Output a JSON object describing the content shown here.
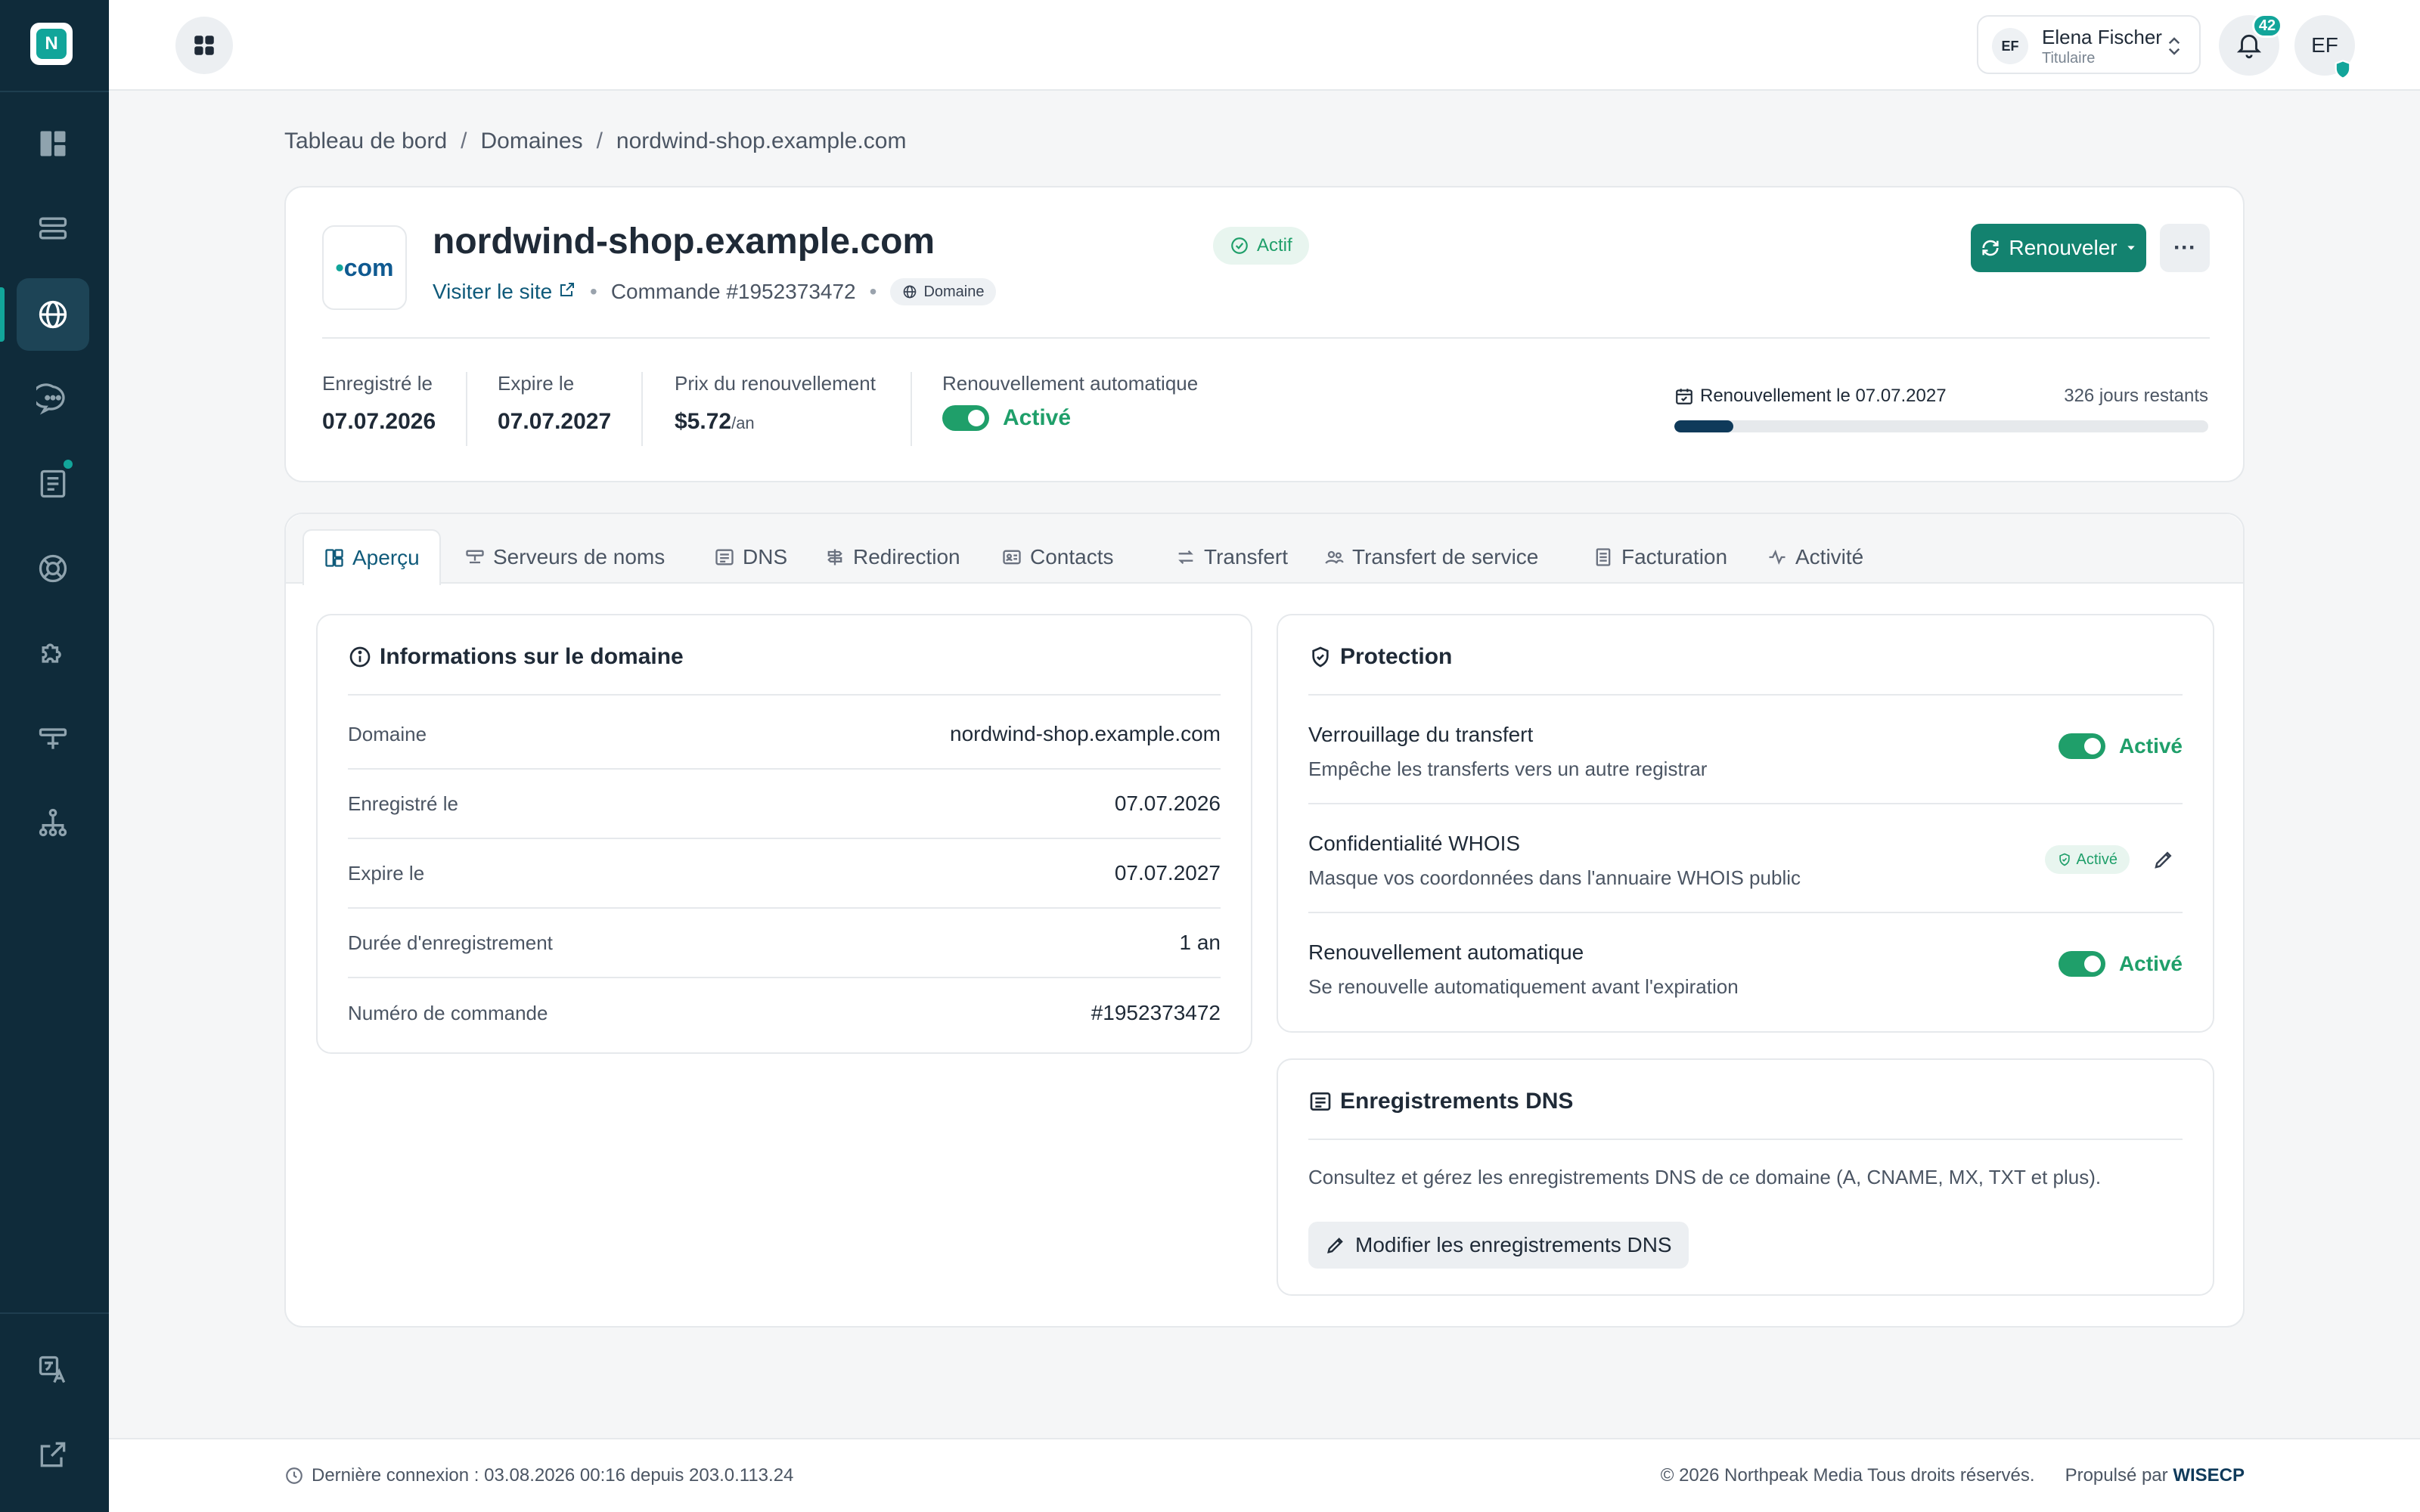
{
  "app": {
    "logo_letter": "N"
  },
  "user": {
    "name": "Elena Fischer",
    "role": "Titulaire",
    "initials": "EF",
    "notifications": "42"
  },
  "breadcrumb": [
    "Tableau de bord",
    "Domaines",
    "nordwind-shop.example.com"
  ],
  "domain": {
    "tld_dot": "•",
    "tld": "com",
    "name": "nordwind-shop.example.com",
    "status": "Actif",
    "visit_label": "Visiter le site",
    "order": "Commande #1952373472",
    "chip": "Domaine",
    "renew_button": "Renouveler",
    "more_button": "···"
  },
  "stats": {
    "registered_label": "Enregistré le",
    "registered_value": "07.07.2026",
    "expires_label": "Expire le",
    "expires_value": "07.07.2027",
    "price_label": "Prix du renouvellement",
    "price_value": "$5.72",
    "price_unit": "/an",
    "auto_label": "Renouvellement automatique",
    "auto_value": "Activé",
    "renewal_date": "Renouvellement le 07.07.2027",
    "days_left": "326 jours restants",
    "progress_pct": 11
  },
  "tabs": [
    "Aperçu",
    "Serveurs de noms",
    "DNS",
    "Redirection",
    "Contacts",
    "Transfert",
    "Transfert de service",
    "Facturation",
    "Activité"
  ],
  "info": {
    "title": "Informations sur le domaine",
    "rows": [
      {
        "k": "Domaine",
        "v": "nordwind-shop.example.com"
      },
      {
        "k": "Enregistré le",
        "v": "07.07.2026"
      },
      {
        "k": "Expire le",
        "v": "07.07.2027"
      },
      {
        "k": "Durée d'enregistrement",
        "v": "1 an"
      },
      {
        "k": "Numéro de commande",
        "v": "#1952373472"
      }
    ]
  },
  "protection": {
    "title": "Protection",
    "rows": [
      {
        "t": "Verrouillage du transfert",
        "d": "Empêche les transferts vers un autre registrar",
        "status": "Activé"
      },
      {
        "t": "Confidentialité WHOIS",
        "d": "Masque vos coordonnées dans l'annuaire WHOIS public",
        "status": "Activé"
      },
      {
        "t": "Renouvellement automatique",
        "d": "Se renouvelle automatiquement avant l'expiration",
        "status": "Activé"
      }
    ]
  },
  "dns": {
    "title": "Enregistrements DNS",
    "text": "Consultez et gérez les enregistrements DNS de ce domaine (A, CNAME, MX, TXT et plus).",
    "button": "Modifier les enregistrements DNS"
  },
  "footer": {
    "last_login": "Dernière connexion : 03.08.2026 00:16 depuis 203.0.113.24",
    "copyright": "© 2026 Northpeak Media Tous droits réservés.",
    "powered": "Propulsé par",
    "brand": "WISECP"
  },
  "colors": {
    "sidebar": "#0f2b3a",
    "accent": "#12a59a",
    "primary_button": "#13826f",
    "success": "#1f9f6a"
  }
}
